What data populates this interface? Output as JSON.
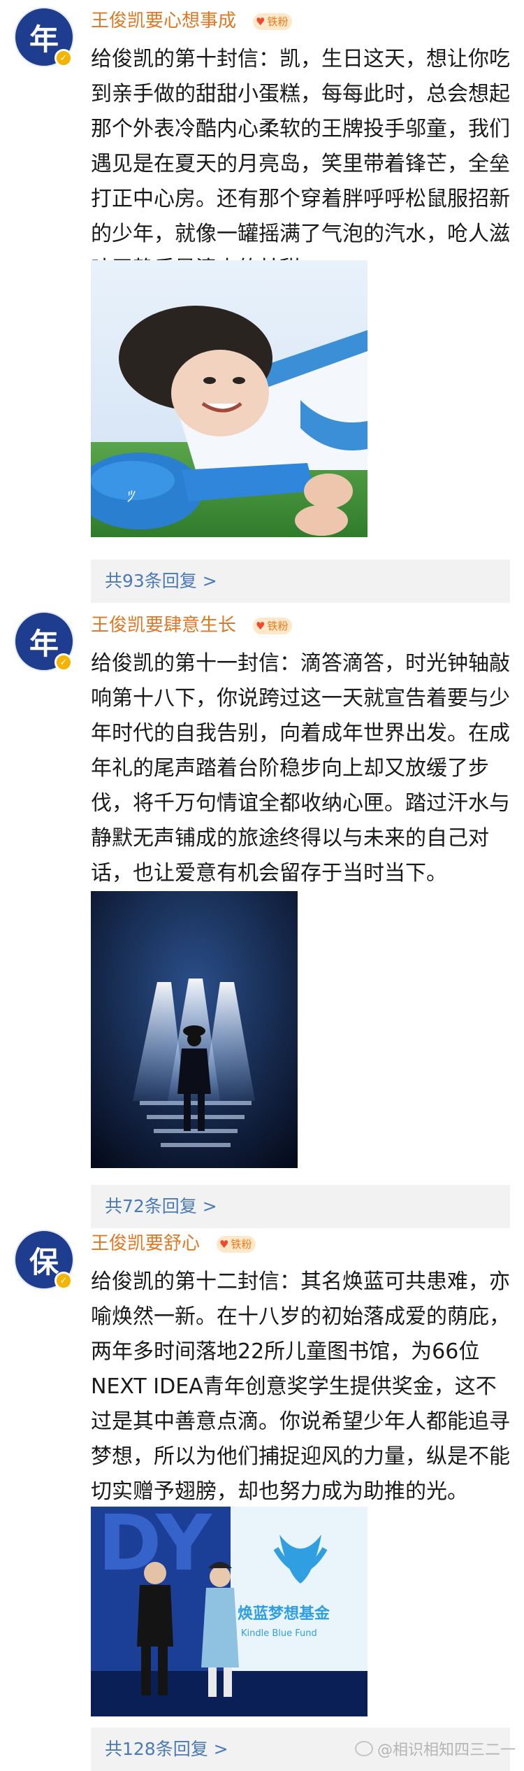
{
  "posts": [
    {
      "avatar_char": "年",
      "username": "王俊凯要心想事成",
      "badge": "铁粉",
      "text": "给俊凯的第十封信：凯，生日这天，想让你吃到亲手做的甜甜小蛋糕，每每此时，总会想起那个外表冷酷内心柔软的王牌投手邬童，我们遇见是在夏天的月亮岛，笑里带着锋芒，全垒打正中心房。还有那个穿着胖呼呼松鼠服招新的少年，就像一罐摇满了气泡的汽水，呛人滋味平静后是清爽的甘甜",
      "image_alt": "photo-boy-lying-on-grass",
      "reply": "共93条回复 >"
    },
    {
      "avatar_char": "年",
      "username": "王俊凯要肆意生长",
      "badge": "铁粉",
      "text": "给俊凯的第十一封信：滴答滴答，时光钟轴敲响第十八下，你说跨过这一天就宣告着要与少年时代的自我告别，向着成年世界出发。在成年礼的尾声踏着台阶稳步向上却又放缓了步伐，将千万句情谊全都收纳心匣。踏过汗水与静默无声铺成的旅途终得以与未来的自己对话，也让爱意有机会留存于当时当下。",
      "image_alt": "photo-stage-spotlights",
      "reply": "共72条回复 >"
    },
    {
      "avatar_char": "保",
      "username": "王俊凯要舒心",
      "badge": "铁粉",
      "text": "给俊凯的第十二封信：其名焕蓝可共患难，亦喻焕然一新。在十八岁的初始落成爱的荫庇，两年多时间落地22所儿童图书馆，为66位NEXT IDEA青年创意奖学生提供奖金，这不过是其中善意点滴。你说希望少年人都能追寻梦想，所以为他们捕捉迎风的力量，纵是不能切实赠予翅膀，却也努力成为助推的光。",
      "image_alt": "photo-kindle-blue-fund-event",
      "image_sign_cn": "焕蓝梦想基金",
      "image_sign_en": "Kindle Blue Fund",
      "image_backdrop_letters": "DY",
      "reply": "共128条回复 >"
    }
  ],
  "watermark": "@相识相知四三二一"
}
